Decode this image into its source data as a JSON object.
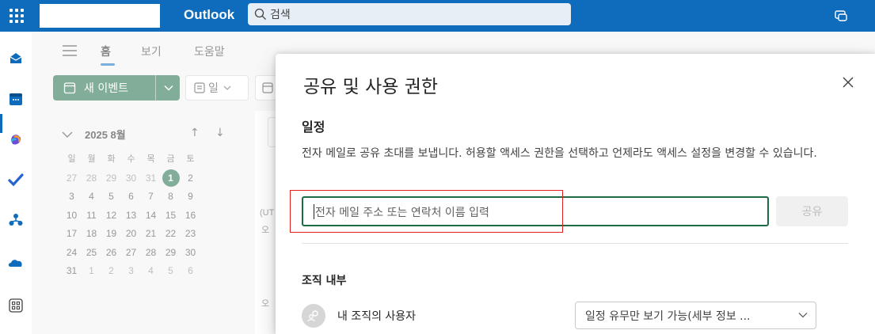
{
  "topbar": {
    "app_name": "Outlook",
    "search_placeholder": "검색"
  },
  "ribbon": {
    "tabs": [
      "홈",
      "보기",
      "도움말"
    ],
    "active_tab": "홈",
    "new_event_label": "새 이벤트",
    "day_view_label": "일"
  },
  "mini_calendar": {
    "month_label": "2025 8월",
    "weekdays": [
      "일",
      "월",
      "화",
      "수",
      "목",
      "금",
      "토"
    ],
    "weeks": [
      [
        "27",
        "28",
        "29",
        "30",
        "31",
        "1",
        "2"
      ],
      [
        "3",
        "4",
        "5",
        "6",
        "7",
        "8",
        "9"
      ],
      [
        "10",
        "11",
        "12",
        "13",
        "14",
        "15",
        "16"
      ],
      [
        "17",
        "18",
        "19",
        "20",
        "21",
        "22",
        "23"
      ],
      [
        "24",
        "25",
        "26",
        "27",
        "28",
        "29",
        "30"
      ],
      [
        "31",
        "1",
        "2",
        "3",
        "4",
        "5",
        "6"
      ]
    ],
    "today": "1"
  },
  "calendar_main": {
    "timezone_fragment": "(UT",
    "hour_fragment_1": "오",
    "hour_fragment_2": "오"
  },
  "dialog": {
    "title": "공유 및 사용 권한",
    "section_title": "일정",
    "description": "전자 메일로 공유 초대를 보냅니다. 허용할 액세스 권한을 선택하고 언제라도 액세스 설정을 변경할 수 있습니다.",
    "email_placeholder": "전자 메일 주소 또는 연락처 이름 입력",
    "share_button": "공유",
    "org_section_title": "조직 내부",
    "org_person_label": "내 조직의 사용자",
    "permission_value": "일정 유무만 보기 가능(세부 정보 ..."
  },
  "colors": {
    "brand_blue": "#0f6cbd",
    "accent_green": "#1d6b45",
    "highlight_red": "#e02020"
  }
}
